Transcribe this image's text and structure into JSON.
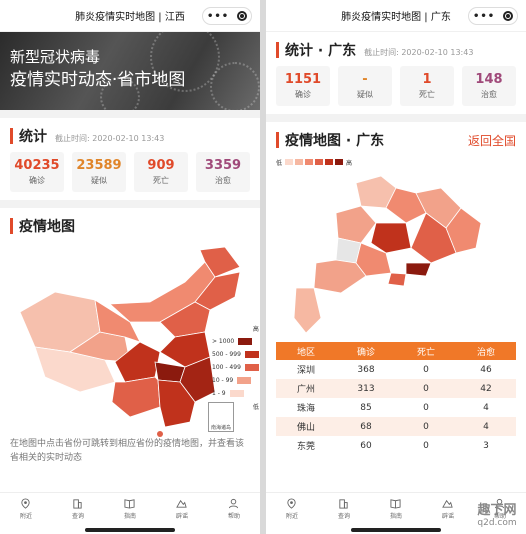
{
  "left": {
    "title": "肺炎疫情实时地图 | 江西",
    "banner": {
      "line1": "新型冠状病毒",
      "line2": "疫情实时动态·省市地图"
    },
    "stats_section": {
      "heading": "统计",
      "time": "截止时间: 2020-02-10 13:43"
    },
    "stats": [
      {
        "value": "40235",
        "label": "确诊",
        "color": "#e04a2a"
      },
      {
        "value": "23589",
        "label": "疑似",
        "color": "#e0852a"
      },
      {
        "value": "909",
        "label": "死亡",
        "color": "#e04a2a"
      },
      {
        "value": "3359",
        "label": "治愈",
        "color": "#a04a7a"
      }
    ],
    "map_heading": "疫情地图",
    "legend": {
      "top": "高",
      "bottom": "低",
      "steps": [
        {
          "label": "> 1000",
          "color": "#8b1a0e"
        },
        {
          "label": "500 - 999",
          "color": "#c0321c"
        },
        {
          "label": "100 - 499",
          "color": "#e06048"
        },
        {
          "label": "10 - 99",
          "color": "#f2a28a"
        },
        {
          "label": "1 - 9",
          "color": "#fbd9cc"
        }
      ],
      "inset_label": "南海诸岛"
    },
    "hint": "在地图中点击省份可跳转到相应省份的疫情地图，并查看该省相关的实时动态"
  },
  "right": {
    "title": "肺炎疫情实时地图 | 广东",
    "stats_section": {
      "heading": "统计 · 广东",
      "time": "截止时间: 2020-02-10 13:43"
    },
    "stats": [
      {
        "value": "1151",
        "label": "确诊",
        "color": "#e04a2a"
      },
      {
        "value": "-",
        "label": "疑似",
        "color": "#e0852a"
      },
      {
        "value": "1",
        "label": "死亡",
        "color": "#e04a2a"
      },
      {
        "value": "148",
        "label": "治愈",
        "color": "#a04a7a"
      }
    ],
    "map_heading": "疫情地图 · 广东",
    "back_link": "返回全国",
    "legend": {
      "low": "低",
      "high": "高"
    },
    "table": {
      "headers": [
        "地区",
        "确诊",
        "死亡",
        "治愈"
      ],
      "rows": [
        [
          "深圳",
          "368",
          "0",
          "46"
        ],
        [
          "广州",
          "313",
          "0",
          "42"
        ],
        [
          "珠海",
          "85",
          "0",
          "4"
        ],
        [
          "佛山",
          "68",
          "0",
          "4"
        ],
        [
          "东莞",
          "60",
          "0",
          "3"
        ]
      ]
    }
  },
  "tabs": [
    {
      "label": "附近",
      "icon": "location-icon"
    },
    {
      "label": "查询",
      "icon": "search-icon"
    },
    {
      "label": "指南",
      "icon": "book-icon"
    },
    {
      "label": "辟谣",
      "icon": "mountain-icon"
    },
    {
      "label": "帮助",
      "icon": "person-icon"
    }
  ],
  "watermark": {
    "line1": "趣下网",
    "line2": "q2d.com"
  }
}
